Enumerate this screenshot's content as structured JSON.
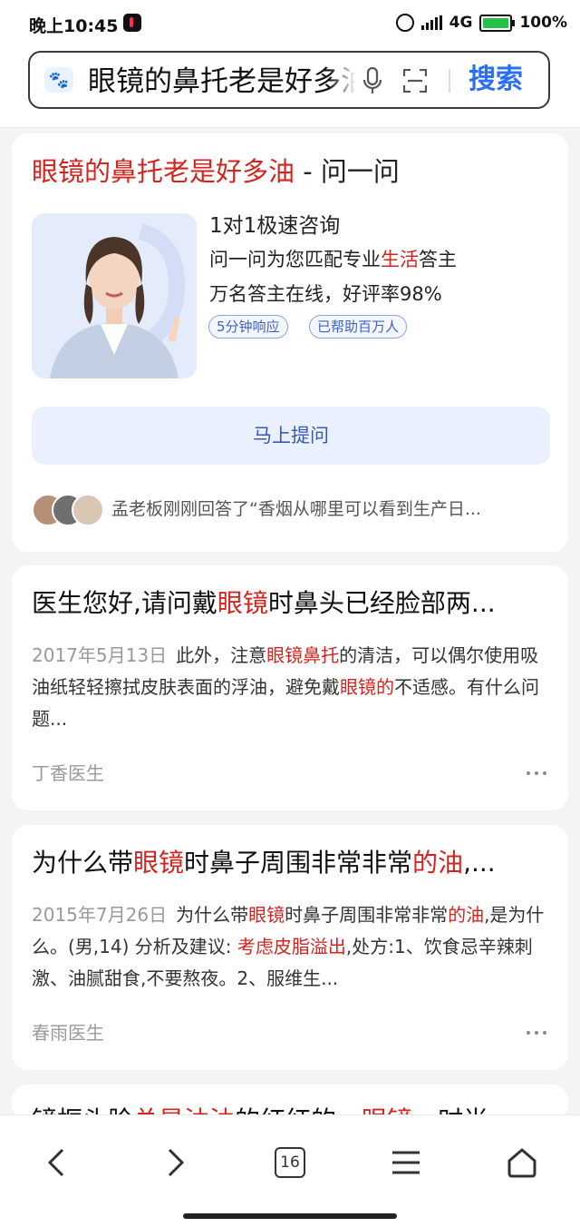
{
  "status_bar": {
    "time": "晚上10:45",
    "network": "4G",
    "battery": "100%",
    "icons": [
      "tiktok-icon",
      "alarm-icon",
      "signal-icon",
      "battery-icon"
    ]
  },
  "search": {
    "query": "眼镜的鼻托老是好多油",
    "button_label": "搜索",
    "icons": [
      "paw-icon",
      "mic-icon",
      "scan-icon"
    ]
  },
  "ask_card": {
    "title_highlight": "眼镜的鼻托老是好多油",
    "title_sep": " - ",
    "title_suffix": "问一问",
    "consult_title": "1对1极速咨询",
    "line1_prefix": "问一问为您匹配专业",
    "line1_highlight": "生活",
    "line1_suffix": "答主",
    "line2": "万名答主在线，好评率98%",
    "tags": [
      "5分钟响应",
      "已帮助百万人"
    ],
    "ask_button": "马上提问",
    "recent_answer": "孟老板刚刚回答了“香烟从哪里可以看到生产日..."
  },
  "results": [
    {
      "title_parts": [
        {
          "text": "医生您好,请问戴",
          "hl": false
        },
        {
          "text": "眼镜",
          "hl": true
        },
        {
          "text": "时鼻头已经脸部两...",
          "hl": false
        }
      ],
      "date": "2017年5月13日",
      "snippet_parts": [
        {
          "text": "此外，注意",
          "hl": false
        },
        {
          "text": "眼镜鼻托",
          "hl": true
        },
        {
          "text": "的清洁，可以偶尔使用吸油纸轻轻擦拭皮肤表面的浮油，避免戴",
          "hl": false
        },
        {
          "text": "眼镜的",
          "hl": true
        },
        {
          "text": "不适感。有什么问题...",
          "hl": false
        }
      ],
      "source": "丁香医生"
    },
    {
      "title_parts": [
        {
          "text": "为什么带",
          "hl": false
        },
        {
          "text": "眼镜",
          "hl": true
        },
        {
          "text": "时鼻子周围非常非常",
          "hl": false
        },
        {
          "text": "的油",
          "hl": true
        },
        {
          "text": ",...",
          "hl": false
        }
      ],
      "date": "2015年7月26日",
      "snippet_parts": [
        {
          "text": "为什么带",
          "hl": false
        },
        {
          "text": "眼镜",
          "hl": true
        },
        {
          "text": "时鼻子周围非常非常",
          "hl": false
        },
        {
          "text": "的油",
          "hl": true
        },
        {
          "text": ",是为什么。(男,14) 分析及建议: ",
          "hl": false
        },
        {
          "text": "考虑皮脂溢出",
          "hl": true
        },
        {
          "text": ",处方:1、饮食忌辛辣刺激、油腻甜食,不要熬夜。2、服维生...",
          "hl": false
        }
      ],
      "source": "春雨医生"
    },
    {
      "title_parts": [
        {
          "text": "镜框头脸",
          "hl": false
        },
        {
          "text": "总是油油",
          "hl": true
        },
        {
          "text": "的红红的，",
          "hl": false
        },
        {
          "text": "眼镜",
          "hl": true
        },
        {
          "text": "，时尚",
          "hl": false
        }
      ]
    }
  ],
  "bottom_nav": {
    "tab_count": "16",
    "icons": [
      "back-icon",
      "forward-icon",
      "tabs-icon",
      "menu-icon",
      "home-icon"
    ]
  },
  "colors": {
    "highlight": "#d3241f",
    "accent": "#2c6ef2",
    "ask_button_bg": "#eaf0fd"
  }
}
